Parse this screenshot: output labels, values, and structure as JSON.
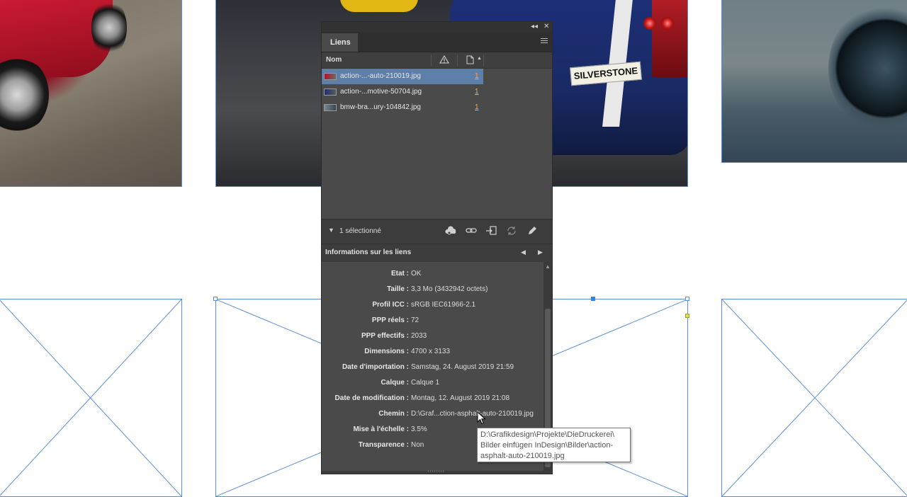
{
  "panel": {
    "tab_label": "Liens",
    "columns": {
      "name": "Nom"
    },
    "links": [
      {
        "name": "action-...-auto-210019.jpg",
        "page": "1",
        "selected": true
      },
      {
        "name": "action-...motive-50704.jpg",
        "page": "1",
        "selected": false
      },
      {
        "name": "bmw-bra...ury-104842.jpg",
        "page": "1",
        "selected": false
      }
    ],
    "selection_count": "1 sélectionné",
    "info_title": "Informations sur les liens",
    "info": [
      {
        "label": "Etat :",
        "value": "OK"
      },
      {
        "label": "Taille :",
        "value": "3,3 Mo (3432942 octets)"
      },
      {
        "label": "Profil ICC :",
        "value": "sRGB IEC61966-2.1"
      },
      {
        "label": "PPP réels :",
        "value": "72"
      },
      {
        "label": "PPP effectifs :",
        "value": "2033"
      },
      {
        "label": "Dimensions :",
        "value": "4700 x 3133"
      },
      {
        "label": "Date d'importation :",
        "value": "Samstag, 24. August 2019 21:59"
      },
      {
        "label": "Calque :",
        "value": "Calque 1"
      },
      {
        "label": "Date de modification :",
        "value": "Montag, 12. August 2019 21:08"
      },
      {
        "label": "Chemin :",
        "value": "D:\\Graf...ction-asphalt-auto-210019.jpg"
      },
      {
        "label": "Mise à l'échelle :",
        "value": "3.5%"
      },
      {
        "label": "Transparence :",
        "value": "Non"
      }
    ]
  },
  "tooltip": {
    "lines": [
      "D:\\Grafikdesign\\Projekte\\DieDruckerei\\",
      "Bilder einfügen InDesign\\Bilder\\action-",
      "asphalt-auto-210019.jpg"
    ]
  },
  "canvas": {
    "plate_text": "SILVERSTONE"
  },
  "colors": {
    "frame": "#5b8fd6",
    "panel_bg": "#4a4a4a",
    "selection": "#5d7fa8",
    "page_link": "#ffa54a"
  }
}
